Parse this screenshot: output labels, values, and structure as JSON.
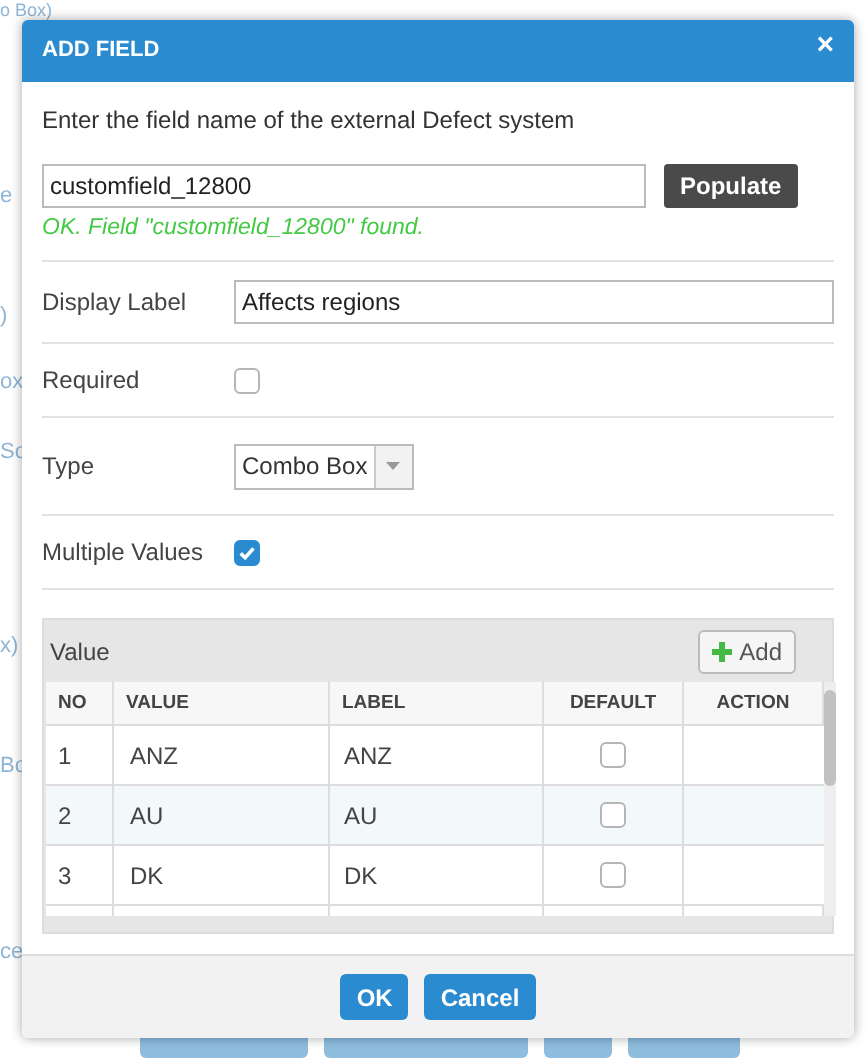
{
  "background": {
    "fragments": [
      "o Box)",
      "e",
      ")",
      "ox",
      "So",
      "x)",
      "Bo",
      "ce"
    ]
  },
  "dialog": {
    "title": "ADD FIELD",
    "close": "×",
    "intro": "Enter the field name of the external Defect system",
    "field_name": {
      "value": "customfield_12800"
    },
    "populate_button": "Populate",
    "status": "OK. Field \"customfield_12800\" found.",
    "form": [
      {
        "kind": "text",
        "label": "Display Label",
        "value": "Affects regions"
      },
      {
        "kind": "checkbox",
        "label": "Required",
        "checked": false
      },
      {
        "kind": "select",
        "label": "Type",
        "value": "Combo Box"
      },
      {
        "kind": "checkbox",
        "label": "Multiple Values",
        "checked": true
      }
    ],
    "values_panel": {
      "title": "Value",
      "add_button": "Add",
      "columns": [
        "NO",
        "VALUE",
        "LABEL",
        "DEFAULT",
        "ACTION"
      ],
      "rows": [
        {
          "no": "1",
          "value": "ANZ",
          "label": "ANZ",
          "default": false
        },
        {
          "no": "2",
          "value": "AU",
          "label": "AU",
          "default": false
        },
        {
          "no": "3",
          "value": "DK",
          "label": "DK",
          "default": false
        }
      ]
    },
    "buttons": [
      "OK",
      "Cancel"
    ]
  }
}
